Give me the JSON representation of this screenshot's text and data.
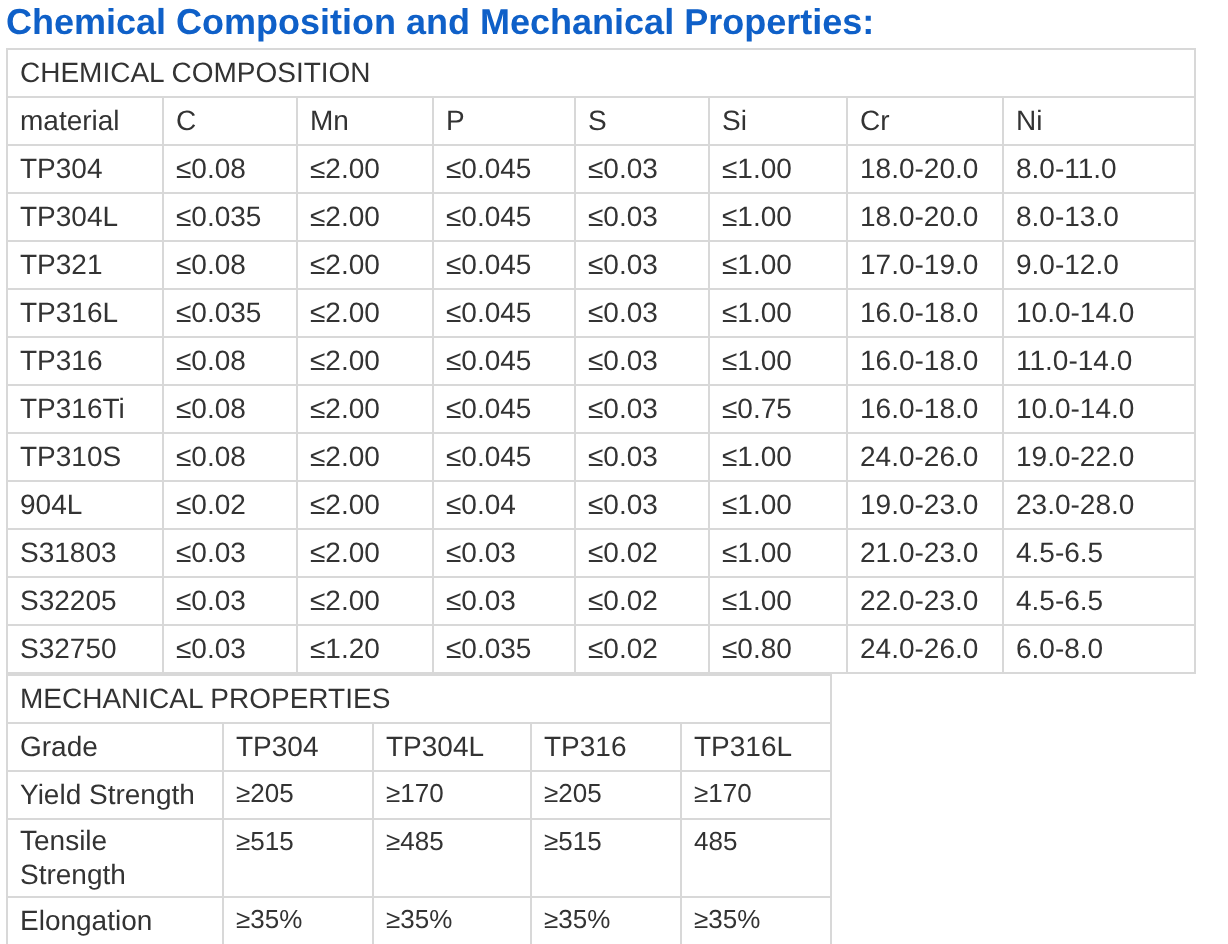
{
  "heading": "Chemical Composition and Mechanical Properties:",
  "chemical_composition": {
    "title": "CHEMICAL COMPOSITION",
    "columns": [
      "material",
      "C",
      "Mn",
      "P",
      "S",
      "Si",
      "Cr",
      "Ni"
    ],
    "rows": [
      [
        "TP304",
        "≤0.08",
        "≤2.00",
        "≤0.045",
        "≤0.03",
        "≤1.00",
        "18.0-20.0",
        "8.0-11.0"
      ],
      [
        "TP304L",
        "≤0.035",
        "≤2.00",
        "≤0.045",
        "≤0.03",
        "≤1.00",
        "18.0-20.0",
        "8.0-13.0"
      ],
      [
        "TP321",
        "≤0.08",
        "≤2.00",
        "≤0.045",
        "≤0.03",
        "≤1.00",
        "17.0-19.0",
        "9.0-12.0"
      ],
      [
        "TP316L",
        "≤0.035",
        "≤2.00",
        "≤0.045",
        "≤0.03",
        "≤1.00",
        "16.0-18.0",
        "10.0-14.0"
      ],
      [
        "TP316",
        "≤0.08",
        "≤2.00",
        "≤0.045",
        "≤0.03",
        "≤1.00",
        "16.0-18.0",
        "11.0-14.0"
      ],
      [
        "TP316Ti",
        "≤0.08",
        "≤2.00",
        "≤0.045",
        "≤0.03",
        "≤0.75",
        "16.0-18.0",
        "10.0-14.0"
      ],
      [
        "TP310S",
        "≤0.08",
        "≤2.00",
        "≤0.045",
        "≤0.03",
        "≤1.00",
        "24.0-26.0",
        "19.0-22.0"
      ],
      [
        "904L",
        "≤0.02",
        "≤2.00",
        "≤0.04",
        "≤0.03",
        "≤1.00",
        "19.0-23.0",
        "23.0-28.0"
      ],
      [
        "S31803",
        "≤0.03",
        "≤2.00",
        "≤0.03",
        "≤0.02",
        "≤1.00",
        "21.0-23.0",
        "4.5-6.5"
      ],
      [
        "S32205",
        "≤0.03",
        "≤2.00",
        "≤0.03",
        "≤0.02",
        "≤1.00",
        "22.0-23.0",
        "4.5-6.5"
      ],
      [
        "S32750",
        "≤0.03",
        "≤1.20",
        "≤0.035",
        "≤0.02",
        "≤0.80",
        "24.0-26.0",
        "6.0-8.0"
      ]
    ]
  },
  "mechanical_properties": {
    "title": "MECHANICAL PROPERTIES",
    "columns": [
      "Grade",
      "TP304",
      "TP304L",
      "TP316",
      "TP316L"
    ],
    "rows": [
      [
        "Yield Strength",
        "≥205",
        "≥170",
        "≥205",
        "≥170"
      ],
      [
        "Tensile Strength",
        "≥515",
        "≥485",
        "≥515",
        "485"
      ],
      [
        "Elongation",
        "≥35%",
        "≥35%",
        "≥35%",
        "≥35%"
      ]
    ]
  }
}
